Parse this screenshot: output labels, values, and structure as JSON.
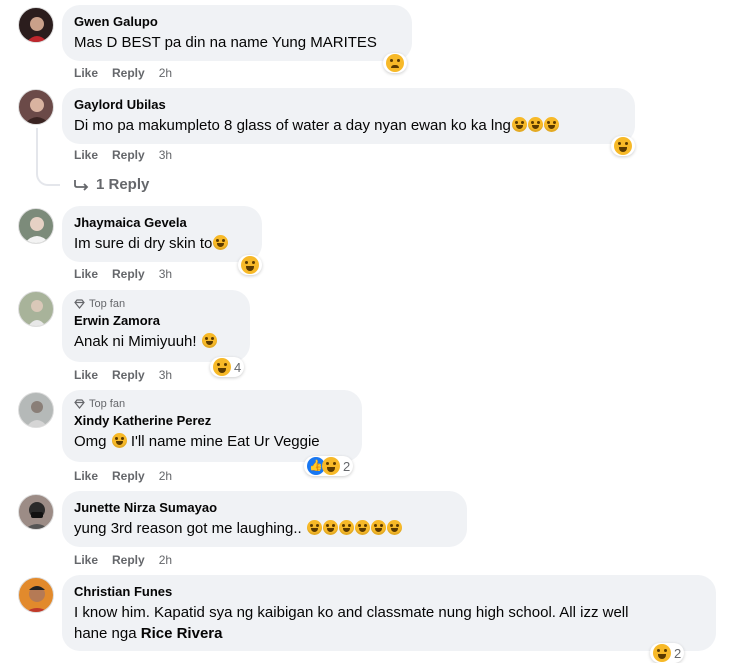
{
  "comments": [
    {
      "author": "Gwen Galupo",
      "text": "Mas D BEST pa din na name Yung MARITES",
      "like": "Like",
      "reply": "Reply",
      "time": "2h",
      "avatar_color": "#2b1d1d"
    },
    {
      "author": "Gaylord Ubilas",
      "text": "Di mo pa makumpleto 8 glass of water a day nyan ewan ko ka lng",
      "like": "Like",
      "reply": "Reply",
      "time": "3h",
      "replies_label": "1 Reply",
      "avatar_color": "#6b4a48"
    },
    {
      "author": "Jhaymaica Gevela",
      "text": "Im sure di dry skin to",
      "like": "Like",
      "reply": "Reply",
      "time": "3h",
      "avatar_color": "#7c8b7a"
    },
    {
      "badge": "Top fan",
      "author": "Erwin Zamora",
      "text": "Anak ni Mimiyuuh!",
      "like": "Like",
      "reply": "Reply",
      "time": "3h",
      "reaction_count": "4",
      "avatar_color": "#a8b39a"
    },
    {
      "badge": "Top fan",
      "author": "Xindy Katherine Perez",
      "text": "Omg",
      "text_after": "I'll name mine Eat Ur Veggie",
      "like": "Like",
      "reply": "Reply",
      "time": "2h",
      "reaction_count": "2",
      "avatar_color": "#b5b9b8"
    },
    {
      "author": "Junette Nirza Sumayao",
      "text": "yung 3rd reason got me laughing..",
      "like": "Like",
      "reply": "Reply",
      "time": "2h",
      "avatar_color": "#9c8c86"
    },
    {
      "author": "Christian Funes",
      "text_line1": "I know him. Kapatid sya ng kaibigan ko and classmate nung high school. All izz well",
      "text_line2_prefix": "hane nga",
      "mention": "Rice Rivera",
      "reaction_count": "2",
      "avatar_color": "#e28a2c"
    }
  ],
  "colors": {
    "bubble": "#f0f2f5",
    "meta": "#65676b",
    "like_blue": "#1877f2",
    "emoji_yellow": "#f7b928"
  },
  "icons": [
    "diamond-icon",
    "reply-arrow-icon",
    "laughing-emoji-icon",
    "sad-emoji-icon",
    "like-reaction-icon"
  ]
}
